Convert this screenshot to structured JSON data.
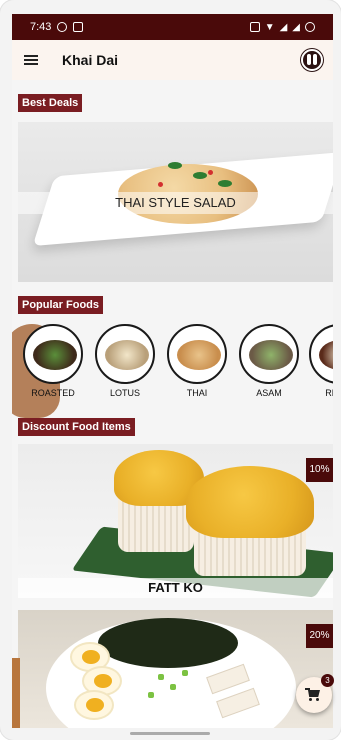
{
  "statusbar": {
    "time": "7:43"
  },
  "appbar": {
    "title": "Khai Dai"
  },
  "sections": {
    "best_deals": "Best Deals",
    "popular_foods": "Popular Foods",
    "discount_items": "Discount Food Items"
  },
  "banner": {
    "caption": "THAI STYLE SALAD"
  },
  "popular_foods": [
    {
      "name": "ROASTED"
    },
    {
      "name": "LOTUS"
    },
    {
      "name": "THAI"
    },
    {
      "name": "ASAM"
    },
    {
      "name": "RED B"
    }
  ],
  "discounts": [
    {
      "badge": "10%",
      "caption": "FATT KO"
    },
    {
      "badge": "20%",
      "caption": ""
    }
  ],
  "cart": {
    "count": "3"
  },
  "colors": {
    "accent": "#7a1d22",
    "statusbar": "#4a0a0a",
    "appbar": "#fbf4ef"
  },
  "icons": [
    "menu-icon",
    "profile-icon",
    "cart-icon"
  ]
}
